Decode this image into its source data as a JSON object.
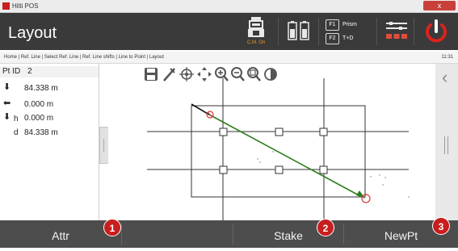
{
  "window": {
    "title": "Hilti POS",
    "close_label": "x"
  },
  "header": {
    "title": "Layout",
    "instrument_status": "C.M. On",
    "f1_key": "F1",
    "f1_label": "Prism",
    "f2_key": "F2",
    "f2_label": "T+D"
  },
  "breadcrumb": {
    "path": "Home | Ref. Line | Select Ref. Line | Ref. Line shifts | Line to Point | Layout",
    "time": "11:31"
  },
  "point_info": {
    "id_label": "Pt ID",
    "id_value": "2",
    "row1_value": "84.338 m",
    "row2_value": "0.000 m",
    "row3_label": "h",
    "row3_value": "0.000 m",
    "row4_label": "d",
    "row4_value": "84.338 m"
  },
  "toolbar": {
    "icons": [
      "save-icon",
      "measure-icon",
      "target-icon",
      "pan-icon",
      "zoom-in-icon",
      "zoom-out-icon",
      "zoom-fit-icon",
      "contrast-icon"
    ]
  },
  "footer": {
    "attr_label": "Attr",
    "stake_label": "Stake",
    "newpt_label": "NewPt"
  },
  "callouts": {
    "one": "1",
    "two": "2",
    "three": "3"
  },
  "colors": {
    "header_bg": "#3a3a3a",
    "footer_bg": "#4d4d4d",
    "accent_red": "#c81e1e",
    "layout_line": "#2e7d1e"
  }
}
